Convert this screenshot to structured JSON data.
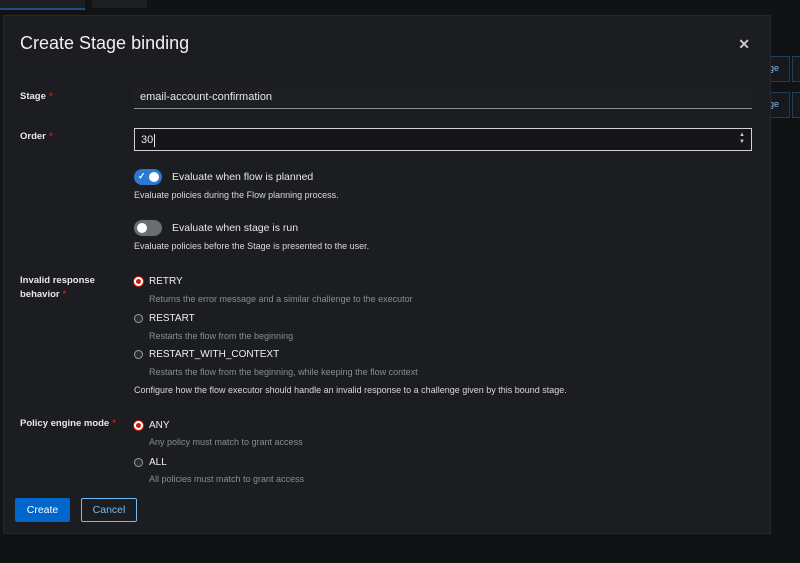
{
  "modal": {
    "title": "Create Stage binding",
    "close_icon": "close-icon"
  },
  "stage": {
    "label": "Stage",
    "required": "*",
    "value": "email-account-confirmation"
  },
  "order": {
    "label": "Order",
    "required": "*",
    "value": "30"
  },
  "evaluate_planned": {
    "label": "Evaluate when flow is planned",
    "help": "Evaluate policies during the Flow planning process.",
    "checked": true
  },
  "evaluate_run": {
    "label": "Evaluate when stage is run",
    "help": "Evaluate policies before the Stage is presented to the user.",
    "checked": false
  },
  "invalid_response": {
    "label_line1": "Invalid response",
    "label_line2": "behavior",
    "required": "*",
    "options": [
      {
        "label": "RETRY",
        "desc": "Returns the error message and a similar challenge to the executor",
        "selected": true
      },
      {
        "label": "RESTART",
        "desc": "Restarts the flow from the beginning",
        "selected": false
      },
      {
        "label": "RESTART_WITH_CONTEXT",
        "desc": "Restarts the flow from the beginning, while keeping the flow context",
        "selected": false
      }
    ],
    "help": "Configure how the flow executor should handle an invalid response to a challenge given by this bound stage."
  },
  "policy_engine": {
    "label": "Policy engine mode",
    "required": "*",
    "options": [
      {
        "label": "ANY",
        "desc": "Any policy must match to grant access",
        "selected": true
      },
      {
        "label": "ALL",
        "desc": "All policies must match to grant access",
        "selected": false
      }
    ]
  },
  "footer": {
    "create_label": "Create",
    "cancel_label": "Cancel"
  },
  "background": {
    "partial_label_1": "ge",
    "partial_label_2": "ge"
  },
  "colors": {
    "primary": "#0066cc",
    "danger": "#c9190b",
    "link": "#73bcf7"
  }
}
